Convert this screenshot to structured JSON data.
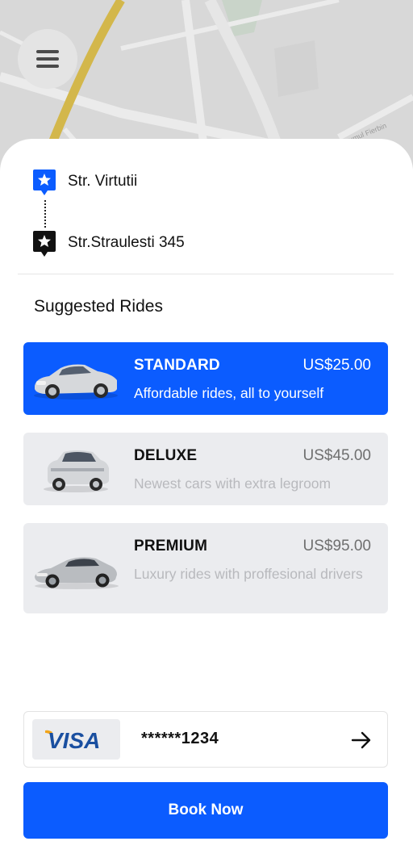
{
  "map": {
    "menu_icon": "hamburger-menu-icon",
    "street_label": "Drumul Fierbin",
    "colors": {
      "background": "#d9d9d9",
      "road_major": "#d6b84a",
      "road_minor": "#ececec",
      "park": "#c8d3c8"
    }
  },
  "route": {
    "from": "Str. Virtutii",
    "to": "Str.Straulesti 345",
    "from_icon": "location-pin-star-icon",
    "to_icon": "location-pin-star-icon",
    "colors": {
      "from_pin": "#0b5cff",
      "to_pin": "#111111"
    }
  },
  "section_title": "Suggested Rides",
  "rides": [
    {
      "name": "STANDARD",
      "price": "US$25.00",
      "description": "Affordable rides, all to yourself",
      "selected": true,
      "icon": "sedan-car-icon"
    },
    {
      "name": "DELUXE",
      "price": "US$45.00",
      "description": "Newest cars with extra legroom",
      "selected": false,
      "icon": "suv-car-icon"
    },
    {
      "name": "PREMIUM",
      "price": "US$95.00",
      "description": "Luxury rides with proffesional drivers",
      "selected": false,
      "icon": "sports-car-icon"
    }
  ],
  "payment": {
    "brand": "VISA",
    "card_number": "******1234",
    "arrow_icon": "arrow-right-icon"
  },
  "book_button": "Book Now",
  "colors": {
    "accent": "#0b5cff",
    "card_bg": "#ebecef",
    "muted_text": "#b8b9bd"
  }
}
